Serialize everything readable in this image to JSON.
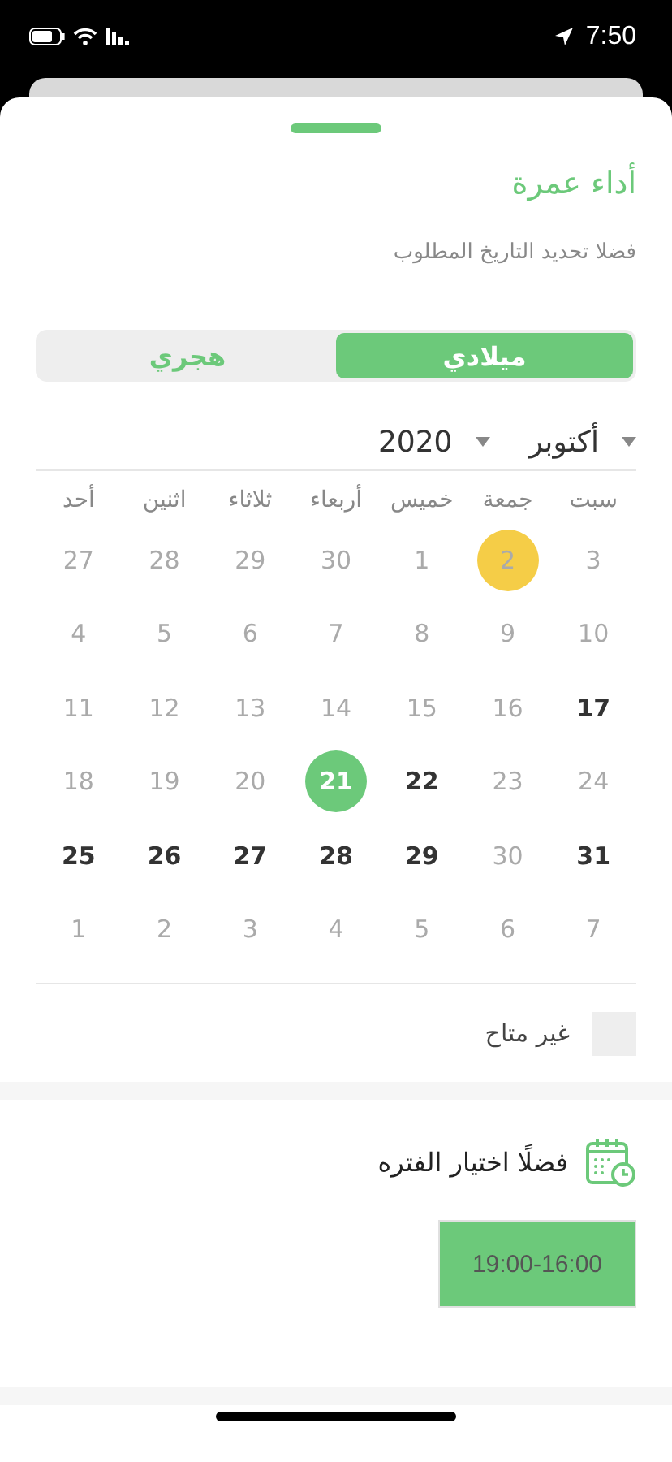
{
  "status_bar": {
    "time": "7:50"
  },
  "sheet": {
    "title": "أداء عمرة",
    "subtitle": "فضلا تحديد التاريخ المطلوب"
  },
  "calendar_tabs": [
    {
      "label": "ميلادي",
      "selected": true
    },
    {
      "label": "هجري",
      "selected": false
    }
  ],
  "month_picker": {
    "month": "أكتوبر",
    "year": "2020"
  },
  "weekdays": [
    "سبت",
    "جمعة",
    "خميس",
    "أربعاء",
    "ثلاثاء",
    "اثنين",
    "أحد"
  ],
  "weeks": [
    [
      {
        "day": "3",
        "available": false,
        "today": false,
        "selected": false
      },
      {
        "day": "2",
        "available": false,
        "today": true,
        "selected": false
      },
      {
        "day": "1",
        "available": false,
        "today": false,
        "selected": false
      },
      {
        "day": "30",
        "available": false,
        "today": false,
        "selected": false
      },
      {
        "day": "29",
        "available": false,
        "today": false,
        "selected": false
      },
      {
        "day": "28",
        "available": false,
        "today": false,
        "selected": false
      },
      {
        "day": "27",
        "available": false,
        "today": false,
        "selected": false
      }
    ],
    [
      {
        "day": "10",
        "available": false,
        "today": false,
        "selected": false
      },
      {
        "day": "9",
        "available": false,
        "today": false,
        "selected": false
      },
      {
        "day": "8",
        "available": false,
        "today": false,
        "selected": false
      },
      {
        "day": "7",
        "available": false,
        "today": false,
        "selected": false
      },
      {
        "day": "6",
        "available": false,
        "today": false,
        "selected": false
      },
      {
        "day": "5",
        "available": false,
        "today": false,
        "selected": false
      },
      {
        "day": "4",
        "available": false,
        "today": false,
        "selected": false
      }
    ],
    [
      {
        "day": "17",
        "available": true,
        "today": false,
        "selected": false
      },
      {
        "day": "16",
        "available": false,
        "today": false,
        "selected": false
      },
      {
        "day": "15",
        "available": false,
        "today": false,
        "selected": false
      },
      {
        "day": "14",
        "available": false,
        "today": false,
        "selected": false
      },
      {
        "day": "13",
        "available": false,
        "today": false,
        "selected": false
      },
      {
        "day": "12",
        "available": false,
        "today": false,
        "selected": false
      },
      {
        "day": "11",
        "available": false,
        "today": false,
        "selected": false
      }
    ],
    [
      {
        "day": "24",
        "available": false,
        "today": false,
        "selected": false
      },
      {
        "day": "23",
        "available": false,
        "today": false,
        "selected": false
      },
      {
        "day": "22",
        "available": true,
        "today": false,
        "selected": false
      },
      {
        "day": "21",
        "available": true,
        "today": false,
        "selected": true
      },
      {
        "day": "20",
        "available": false,
        "today": false,
        "selected": false
      },
      {
        "day": "19",
        "available": false,
        "today": false,
        "selected": false
      },
      {
        "day": "18",
        "available": false,
        "today": false,
        "selected": false
      }
    ],
    [
      {
        "day": "31",
        "available": true,
        "today": false,
        "selected": false
      },
      {
        "day": "30",
        "available": false,
        "today": false,
        "selected": false
      },
      {
        "day": "29",
        "available": true,
        "today": false,
        "selected": false
      },
      {
        "day": "28",
        "available": true,
        "today": false,
        "selected": false
      },
      {
        "day": "27",
        "available": true,
        "today": false,
        "selected": false
      },
      {
        "day": "26",
        "available": true,
        "today": false,
        "selected": false
      },
      {
        "day": "25",
        "available": true,
        "today": false,
        "selected": false
      }
    ],
    [
      {
        "day": "7",
        "available": false,
        "today": false,
        "selected": false
      },
      {
        "day": "6",
        "available": false,
        "today": false,
        "selected": false
      },
      {
        "day": "5",
        "available": false,
        "today": false,
        "selected": false
      },
      {
        "day": "4",
        "available": false,
        "today": false,
        "selected": false
      },
      {
        "day": "3",
        "available": false,
        "today": false,
        "selected": false
      },
      {
        "day": "2",
        "available": false,
        "today": false,
        "selected": false
      },
      {
        "day": "1",
        "available": false,
        "today": false,
        "selected": false
      }
    ]
  ],
  "legend": {
    "label": "غير متاح"
  },
  "period_section": {
    "title": "فضلًا اختيار الفتره",
    "slots": [
      {
        "label": "19:00-16:00",
        "selected": true
      }
    ]
  }
}
